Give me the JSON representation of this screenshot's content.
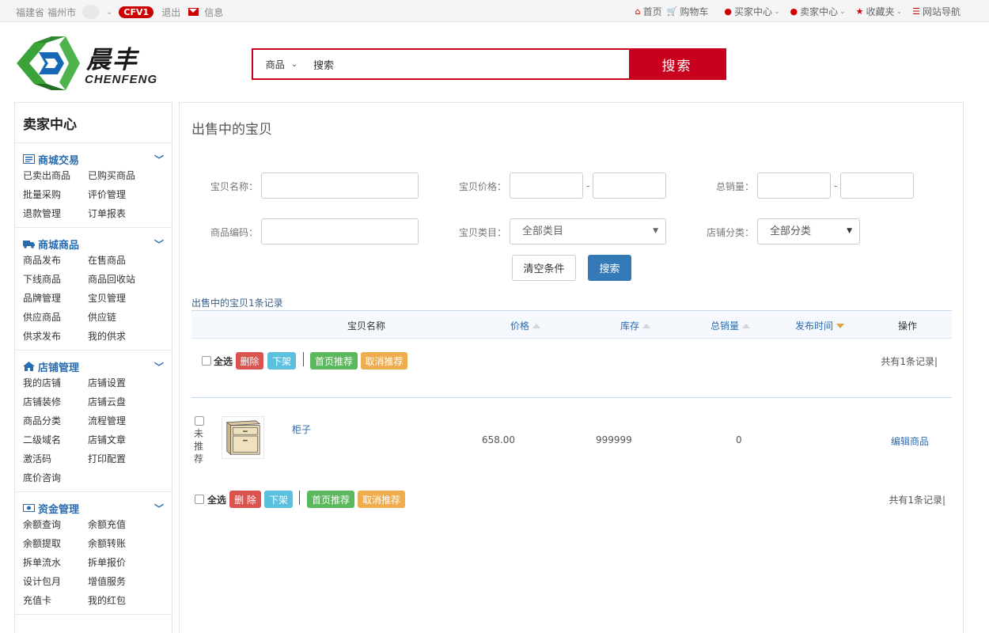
{
  "topbar": {
    "province": "福建省",
    "city": "福州市",
    "level": "CFV1",
    "logout": "退出",
    "message": "信息",
    "nav": [
      {
        "icon": "home-icon",
        "label": "首页",
        "dropdown": false
      },
      {
        "icon": "cart-icon",
        "label": "购物车",
        "dropdown": false
      },
      {
        "icon": "user-icon",
        "label": "买家中心",
        "dropdown": true
      },
      {
        "icon": "user-icon",
        "label": "卖家中心",
        "dropdown": true
      },
      {
        "icon": "star-icon",
        "label": "收藏夹",
        "dropdown": true
      },
      {
        "icon": "sitemap-icon",
        "label": "网站导航",
        "dropdown": false
      }
    ]
  },
  "logo": {
    "cn": "晨丰",
    "en": "CHENFENG"
  },
  "search": {
    "category": "商品",
    "value": "搜索",
    "button": "搜索"
  },
  "sidebar": {
    "title": "卖家中心",
    "groups": [
      {
        "title": "商城交易",
        "icon": "list-icon",
        "items": [
          "已卖出商品",
          "已购买商品",
          "批量采购",
          "评价管理",
          "退款管理",
          "订单报表"
        ]
      },
      {
        "title": "商城商品",
        "icon": "truck-icon",
        "items": [
          "商品发布",
          "在售商品",
          "下线商品",
          "商品回收站",
          "品牌管理",
          "宝贝管理",
          "供应商品",
          "供应链",
          "供求发布",
          "我的供求"
        ]
      },
      {
        "title": "店铺管理",
        "icon": "home-icon",
        "items": [
          "我的店铺",
          "店铺设置",
          "店铺装修",
          "店铺云盘",
          "商品分类",
          "流程管理",
          "二级域名",
          "店铺文章",
          "激活码",
          "打印配置",
          "底价咨询"
        ]
      },
      {
        "title": "资金管理",
        "icon": "money-icon",
        "items": [
          "余额查询",
          "余额充值",
          "余额提取",
          "余额转账",
          "拆单流水",
          "拆单报价",
          "设计包月",
          "增值服务",
          "充值卡",
          "我的红包"
        ]
      }
    ]
  },
  "main": {
    "title": "出售中的宝贝",
    "filters": {
      "name_label": "宝贝名称：",
      "price_label": "宝贝价格：",
      "sales_label": "总销量：",
      "code_label": "商品编码：",
      "category_label": "宝贝类目：",
      "category_value": "全部类目",
      "shopcat_label": "店铺分类：",
      "shopcat_value": "全部分类",
      "range_sep": "-",
      "clear_button": "清空条件",
      "search_button": "搜索"
    },
    "record_summary": "出售中的宝贝1条记录",
    "columns": {
      "name": "宝贝名称",
      "price": "价格",
      "stock": "库存",
      "sales": "总销量",
      "time": "发布时间",
      "action": "操作"
    },
    "bar_top": {
      "select_all": "全选",
      "delete": "删除",
      "offshelf": "下架",
      "recommend": "首页推荐",
      "cancel_recommend": "取消推荐",
      "total": "共有1条记录|"
    },
    "bar_bottom": {
      "select_all": "全选",
      "delete": "删 除",
      "offshelf": "下架",
      "recommend": "首页推荐",
      "cancel_recommend": "取消推荐",
      "total": "共有1条记录|"
    },
    "rows": [
      {
        "status": "未推荐",
        "name": "柜子",
        "price": "658.00",
        "stock": "999999",
        "sales": "0",
        "action": "编辑商品"
      }
    ]
  },
  "colors": {
    "accent_red": "#c9001d",
    "link_blue": "#2a6cb0",
    "primary_blue": "#337ab7"
  }
}
